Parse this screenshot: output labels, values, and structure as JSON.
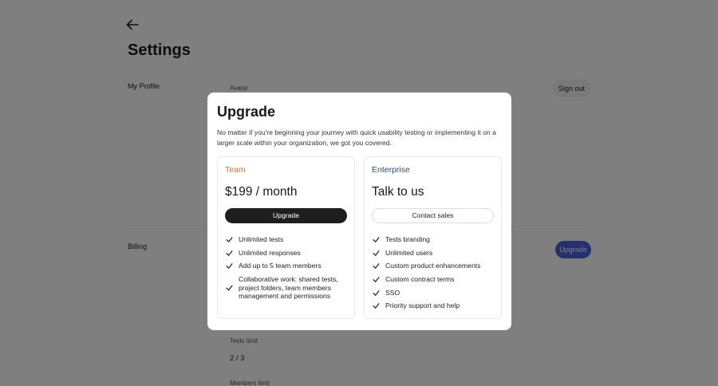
{
  "page": {
    "title": "Settings",
    "sections": {
      "profile": "My Profile",
      "billing": "Billing"
    },
    "fields": {
      "avatar_label": "Avatar",
      "tests_limit_label": "Tests limit",
      "tests_limit_value": "2 / 3",
      "members_limit_label": "Members limit"
    },
    "sign_out_label": "Sign out",
    "billing_upgrade_label": "Upgrade"
  },
  "modal": {
    "title": "Upgrade",
    "description": "No matter if you're beginning your journey with quick usability testing or implementing it on a larger scale within your organization, we got you covered.",
    "plans": [
      {
        "name": "Team",
        "price": "$199 / month",
        "button": "Upgrade",
        "features": [
          "Unlimited tests",
          "Unlimited responses",
          "Add up to 5 team members",
          "Collaborative work: shared tests, project folders, team members management and permissions"
        ]
      },
      {
        "name": "Enterprise",
        "price": "Talk to us",
        "button": "Contact sales",
        "features": [
          "Tests branding",
          "Unlimited users",
          "Custom product enhancements",
          "Custom contract terms",
          "SSO",
          "Priority support and help"
        ]
      }
    ]
  },
  "colors": {
    "team_accent": "#e06b27",
    "enterprise_accent": "#2a4f88",
    "primary_button": "#1e1e1e",
    "billing_upgrade_button": "#4b63d6"
  },
  "icons": {
    "back": "arrow-left-icon",
    "check": "check-icon"
  }
}
